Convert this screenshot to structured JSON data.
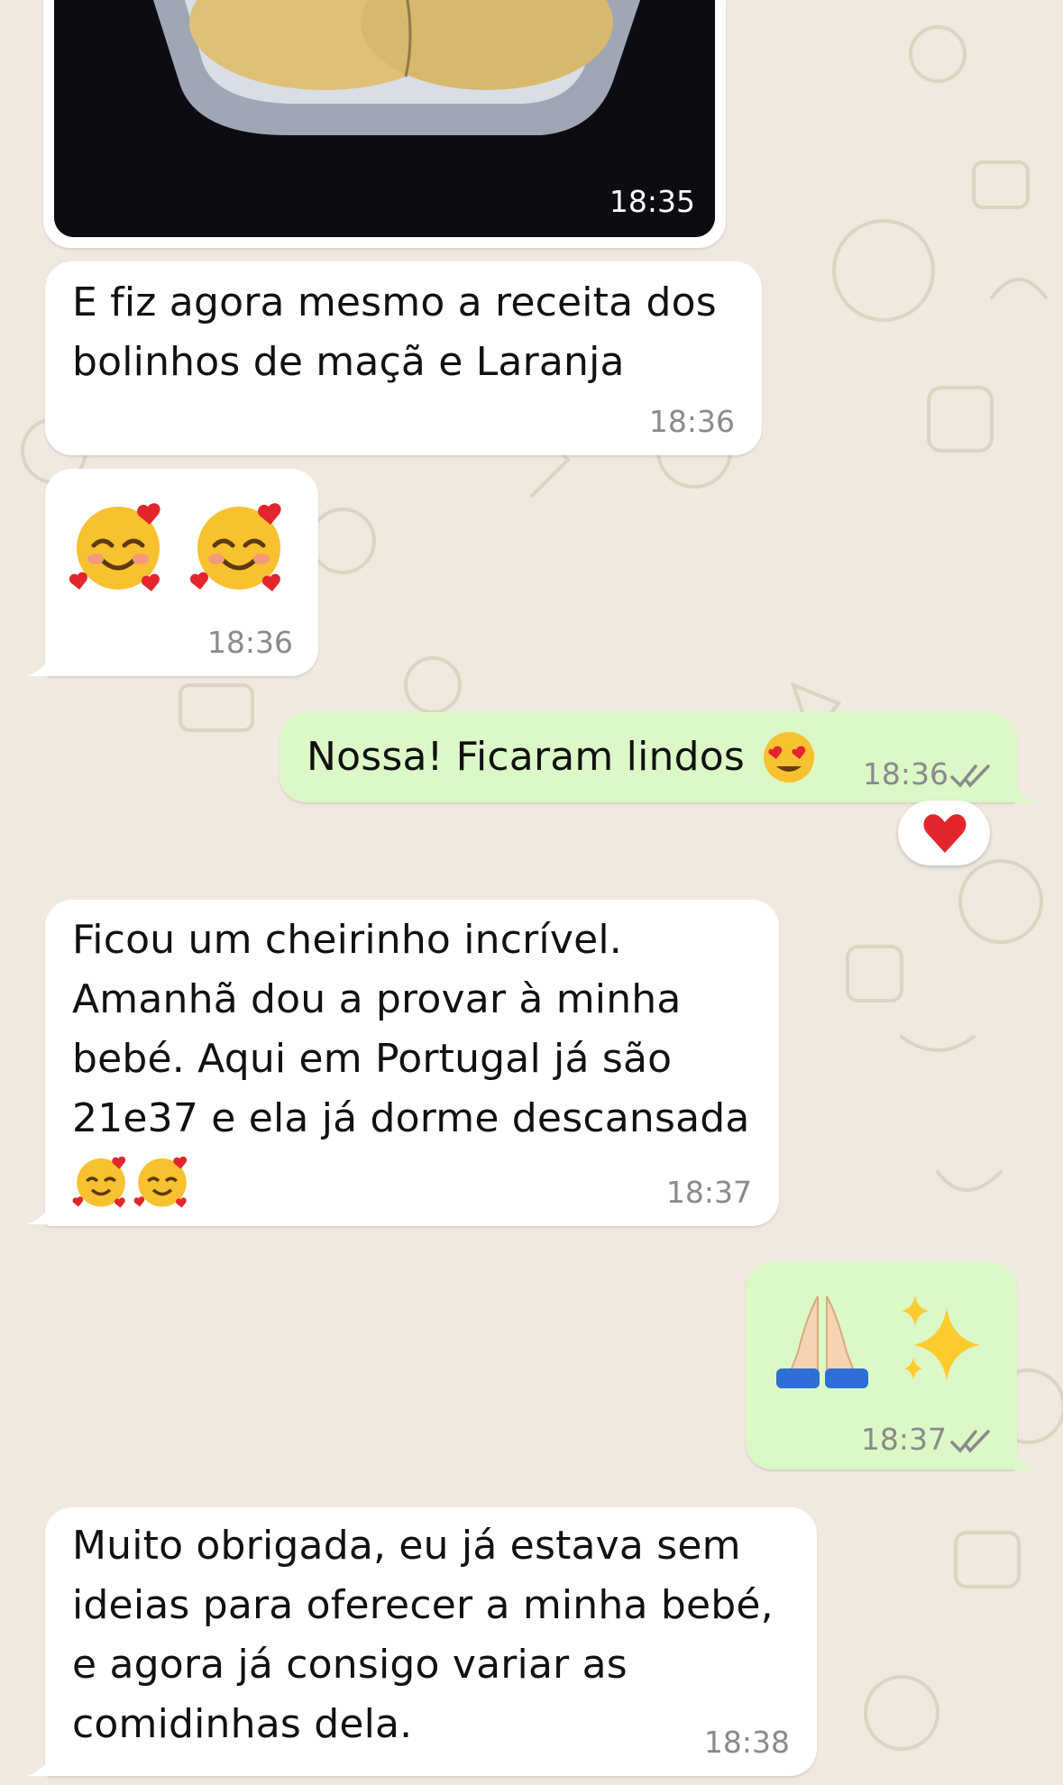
{
  "messages": {
    "photo": {
      "time": "18:35"
    },
    "m1": {
      "text": "E fiz agora mesmo a receita dos\nbolinhos de maçã e Laranja",
      "time": "18:36"
    },
    "m2": {
      "time": "18:36",
      "emoji": "smiling-face-with-hearts"
    },
    "m3": {
      "text": "Nossa! Ficaram lindos",
      "time": "18:36",
      "reaction": "red-heart",
      "emoji": "heart-eyes"
    },
    "m4": {
      "text": "Ficou um cheirinho incrível.\nAmanhã dou a provar à minha\nbebé.  Aqui em Portugal já são\n21e37 e ela já dorme descansada",
      "time": "18:37",
      "emoji": "smiling-face-with-hearts"
    },
    "m5": {
      "time": "18:37",
      "emoji": [
        "folded-hands",
        "sparkles"
      ]
    },
    "m6": {
      "text": "Muito obrigada, eu já estava sem\nideias para oferecer a minha bebé,\ne agora já consigo variar as\ncomidinhas dela.",
      "time": "18:38"
    }
  },
  "colors": {
    "incoming": "#ffffff",
    "outgoing": "#dcf8c6",
    "background": "#efe9df",
    "read_ticks": "#8a8a8a"
  }
}
